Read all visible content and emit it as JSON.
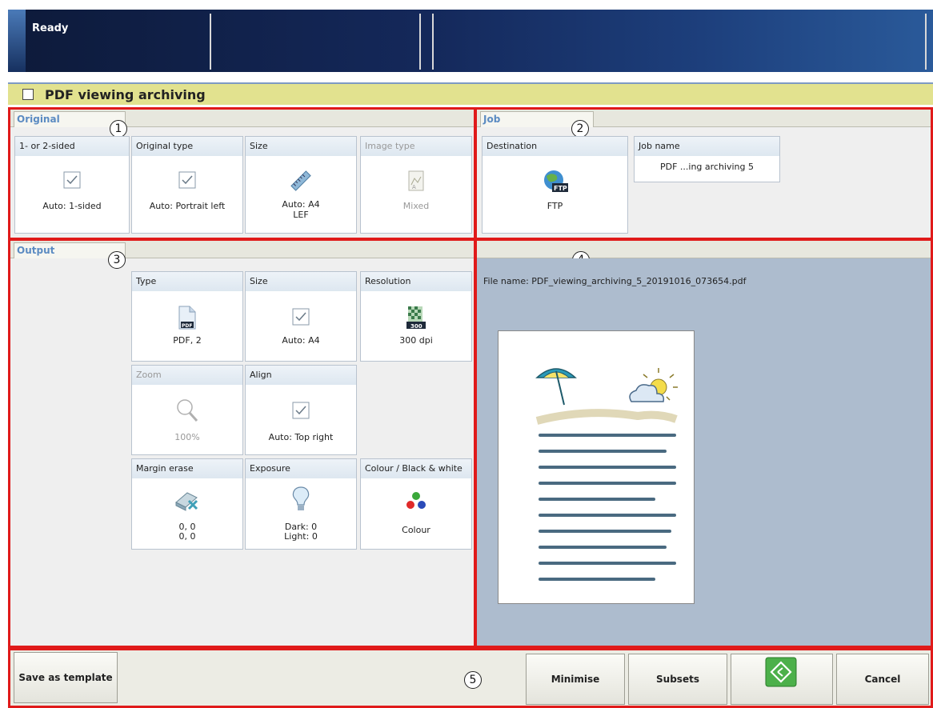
{
  "status": {
    "text": "Ready"
  },
  "title": "PDF viewing archiving",
  "markers": {
    "m1": "1",
    "m2": "2",
    "m3": "3",
    "m4": "4",
    "m5": "5"
  },
  "original": {
    "tab": "Original",
    "tiles": [
      {
        "label": "1- or 2-sided",
        "value": "Auto: 1-sided",
        "icon": "checkbox-icon",
        "disabled": false
      },
      {
        "label": "Original type",
        "value": "Auto: Portrait left",
        "icon": "checkbox-icon",
        "disabled": false
      },
      {
        "label": "Size",
        "value_line1": "Auto: A4",
        "value_line2": "LEF",
        "icon": "ruler-icon",
        "disabled": false
      },
      {
        "label": "Image type",
        "value": "Mixed",
        "icon": "image-type-icon",
        "disabled": true
      }
    ]
  },
  "job": {
    "tab": "Job",
    "destination": {
      "label": "Destination",
      "value": "FTP",
      "icon": "ftp-globe-icon"
    },
    "jobname": {
      "label": "Job name",
      "value": "PDF ...ing archiving 5"
    }
  },
  "output": {
    "tab": "Output",
    "tiles": {
      "type": {
        "label": "Type",
        "value": "PDF, 2",
        "icon": "pdf-file-icon"
      },
      "size": {
        "label": "Size",
        "value": "Auto: A4",
        "icon": "checkbox-icon"
      },
      "resolution": {
        "label": "Resolution",
        "value": "300 dpi",
        "icon": "resolution-icon",
        "badge": "300"
      },
      "zoom": {
        "label": "Zoom",
        "value": "100%",
        "icon": "magnifier-icon",
        "disabled": true
      },
      "align": {
        "label": "Align",
        "value": "Auto: Top right",
        "icon": "checkbox-icon"
      },
      "margin": {
        "label": "Margin erase",
        "value_line1": "0, 0",
        "value_line2": "0, 0",
        "icon": "eraser-icon"
      },
      "exposure": {
        "label": "Exposure",
        "value_line1": "Dark: 0",
        "value_line2": "Light: 0",
        "icon": "lightbulb-icon"
      },
      "colour": {
        "label": "Colour / Black & white",
        "value": "Colour",
        "icon": "colour-dots-icon"
      }
    }
  },
  "preview": {
    "file_name": "File name: PDF_viewing_archiving_5_20191016_073654.pdf"
  },
  "buttons": {
    "save_template": "Save as template",
    "minimise": "Minimise",
    "subsets": "Subsets",
    "cancel": "Cancel"
  },
  "colors": {
    "accent_red": "#e01a1a",
    "title_bar": "#e2e28f",
    "tab_text": "#5b8bc2",
    "start_green": "#4cb04a",
    "preview_bg": "#adbcce"
  }
}
